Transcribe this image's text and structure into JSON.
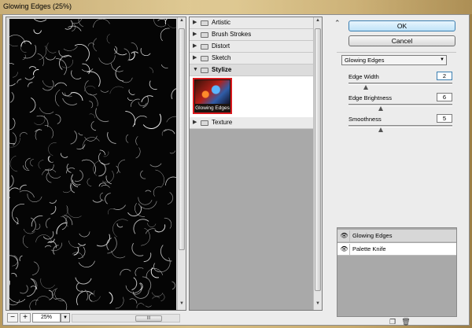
{
  "window": {
    "title": "Glowing Edges (25%)"
  },
  "preview": {
    "zoom": "25%",
    "zoom_out_icon": "minus-icon",
    "zoom_in_icon": "plus-icon",
    "scroll_grip": "III"
  },
  "gallery": {
    "folders": [
      {
        "label": "Artistic",
        "expanded": false
      },
      {
        "label": "Brush Strokes",
        "expanded": false
      },
      {
        "label": "Distort",
        "expanded": false
      },
      {
        "label": "Sketch",
        "expanded": false
      },
      {
        "label": "Stylize",
        "expanded": true
      },
      {
        "label": "Texture",
        "expanded": false
      }
    ],
    "selected_filter": {
      "label": "Glowing Edges"
    }
  },
  "buttons": {
    "ok": "OK",
    "cancel": "Cancel"
  },
  "settings": {
    "filter_select": "Glowing Edges",
    "params": [
      {
        "label": "Edge Width",
        "value": "2",
        "slider": 0.15
      },
      {
        "label": "Edge Brightness",
        "value": "6",
        "slider": 0.3
      },
      {
        "label": "Smoothness",
        "value": "5",
        "slider": 0.3
      }
    ]
  },
  "layers": [
    {
      "label": "Glowing Edges",
      "active": true
    },
    {
      "label": "Palette Knife",
      "active": false
    }
  ],
  "icons": {
    "collapse": "double-chevron-up-icon",
    "new_layer": "new-effect-layer-icon",
    "delete_layer": "trash-icon",
    "eye": "eye-icon"
  },
  "colors": {
    "selection_border": "#d9191d",
    "ok_button": "#bfe3f8",
    "preview_bg": "#050505"
  }
}
